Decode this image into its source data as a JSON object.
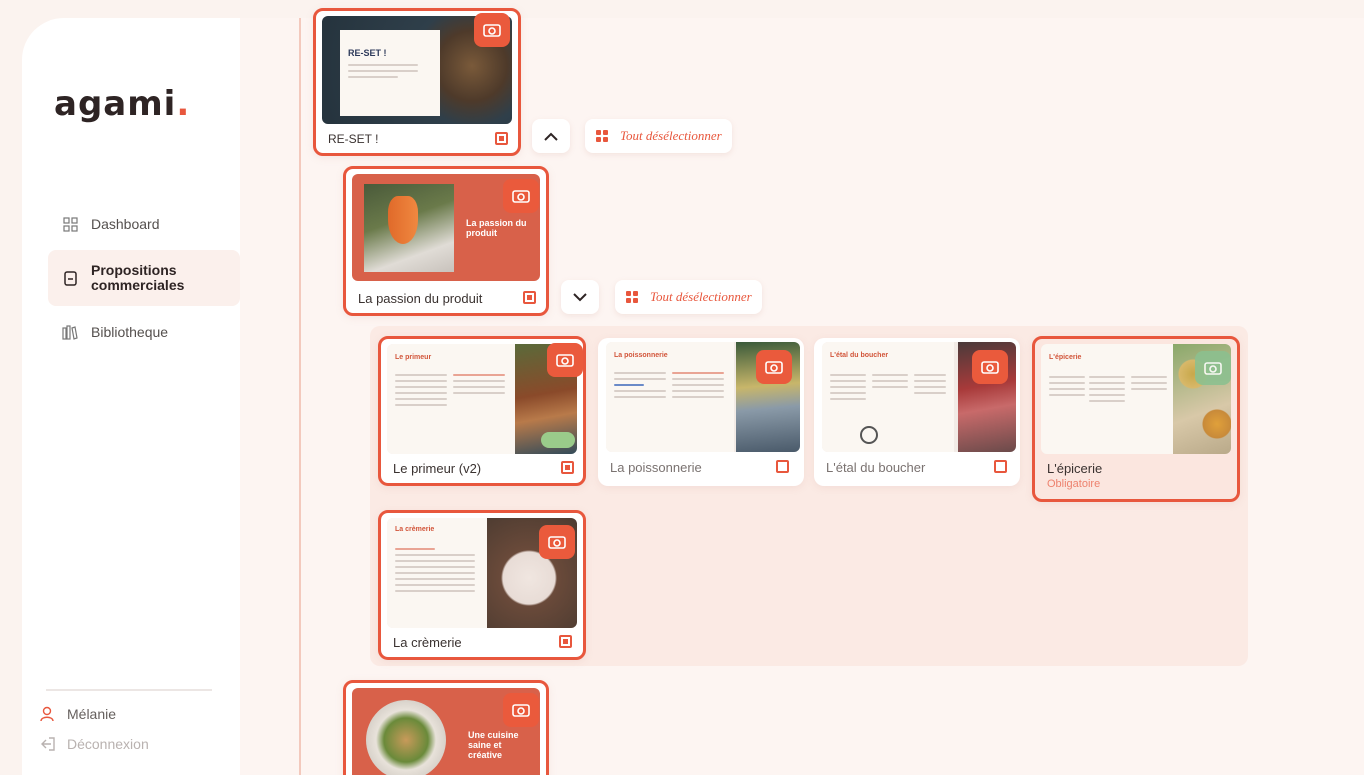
{
  "app": {
    "logo_text": "agami",
    "logo_dot": ".",
    "accent": "#e8573d"
  },
  "nav": {
    "items": [
      {
        "label": "Dashboard",
        "icon": "dashboard-grid-icon"
      },
      {
        "label": "Propositions commerciales",
        "label_line1": "Propositions",
        "label_line2": "commerciales",
        "icon": "document-icon",
        "active": true
      },
      {
        "label": "Bibliotheque",
        "icon": "library-icon"
      }
    ],
    "user": {
      "name": "Mélanie",
      "icon": "user-icon"
    },
    "logout": {
      "label": "Déconnexion",
      "icon": "logout-icon"
    }
  },
  "sections": {
    "reset": {
      "title": "RE-SET !",
      "thumb_heading": "RE-SET !",
      "selected": true
    },
    "passion": {
      "title": "La passion du produit",
      "thumb_heading": "La passion du produit",
      "selected": true
    },
    "cuisine": {
      "thumb_heading": "Une cuisine saine et créative",
      "selected": true
    }
  },
  "controls": {
    "deselect_all": "Tout désélectionner",
    "collapse_icon": "chevron-up-icon",
    "expand_icon": "chevron-down-icon"
  },
  "sub_cards": [
    {
      "title": "Le primeur (v2)",
      "thumb_heading": "Le primeur",
      "selected": true
    },
    {
      "title": "La poissonnerie",
      "thumb_heading": "La poissonnerie",
      "selected": false
    },
    {
      "title": "L'étal du boucher",
      "thumb_heading": "L'étal du boucher",
      "selected": false
    },
    {
      "title": "L'épicerie",
      "thumb_heading": "L'épicerie",
      "subtitle": "Obligatoire",
      "selected": true
    },
    {
      "title": "La crèmerie",
      "thumb_heading": "La crèmerie",
      "selected": true
    }
  ]
}
